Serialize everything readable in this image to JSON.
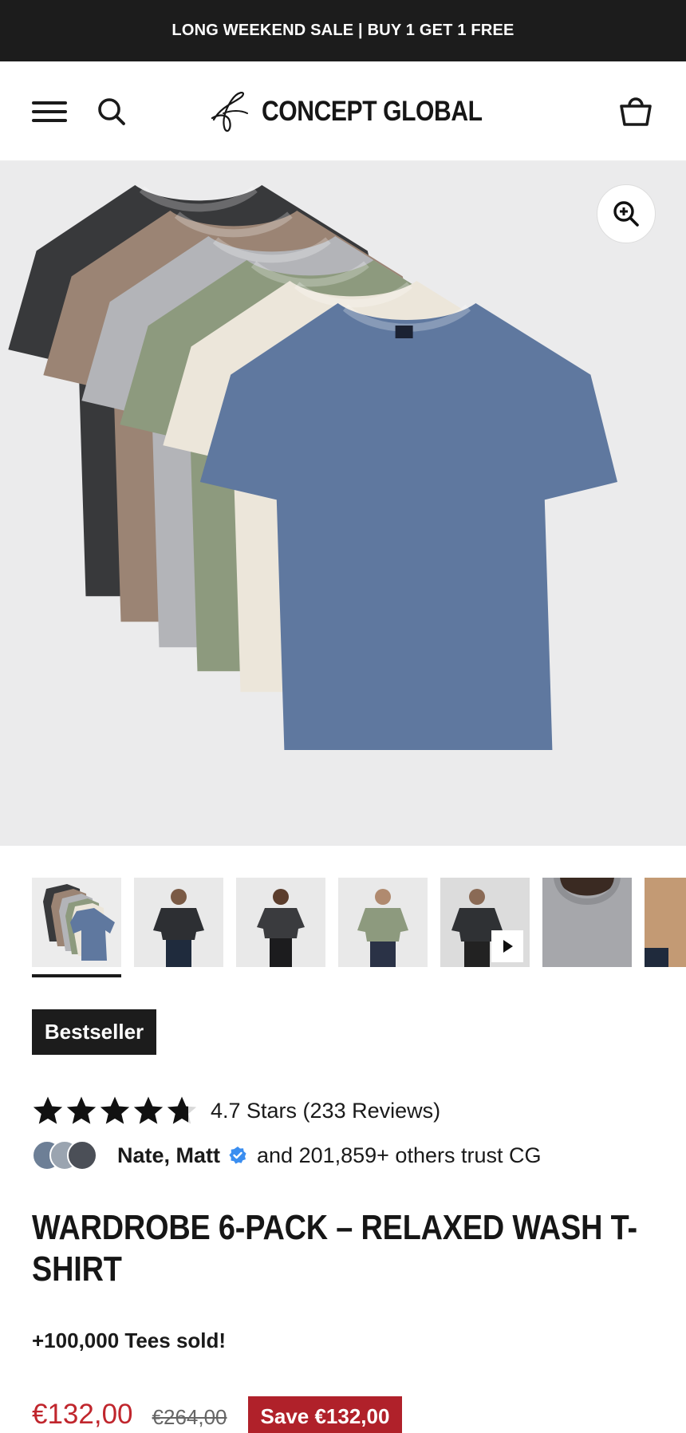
{
  "announcement": {
    "text": "LONG WEEKEND SALE | BUY 1 GET 1 FREE"
  },
  "header": {
    "brand": "CONCEPT GLOBAL",
    "icons": [
      "hamburger-menu-icon",
      "search-icon",
      "cart-icon"
    ]
  },
  "gallery": {
    "hero_icon": "zoom-in-icon",
    "thumbnails": [
      {
        "label": "6-pack tees",
        "active": true
      },
      {
        "label": "model charcoal tee"
      },
      {
        "label": "female model charcoal tee"
      },
      {
        "label": "model olive tee"
      },
      {
        "label": "model video",
        "video": true
      },
      {
        "label": "collar detail"
      },
      {
        "label": "brown tee"
      }
    ],
    "shirt_colors": [
      "#38393b",
      "#9b8474",
      "#b3b4b8",
      "#8d9a7e",
      "#ece6da",
      "#5f789f"
    ]
  },
  "product": {
    "badge": "Bestseller",
    "rating_value": 4.7,
    "rating_text": "4.7 Stars (233 Reviews)",
    "trust_names": "Nate, Matt",
    "trust_text": "and 201,859+ others trust CG",
    "title_line1": "WARDROBE 6-PACK – RELAXED WASH T-",
    "title_line2": "SHIRT",
    "sold": "+100,000 Tees sold!",
    "price": "€132,00",
    "price_old": "€264,00",
    "save": "Save €132,00"
  },
  "colors": {
    "sale_red": "#b0212a",
    "dark": "#1c1c1c",
    "hero_bg": "#ebebec"
  }
}
